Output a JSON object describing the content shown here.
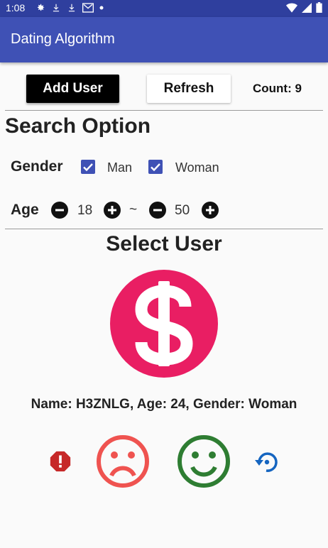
{
  "status_bar": {
    "time": "1:08",
    "icons": [
      "gear-icon",
      "download-icon",
      "download-icon",
      "gmail-icon",
      "dot-icon",
      "wifi-icon",
      "signal-icon",
      "battery-icon"
    ]
  },
  "app_bar": {
    "title": "Dating Algorithm",
    "color": "#3f51b5"
  },
  "toolbar": {
    "add_user_label": "Add User",
    "refresh_label": "Refresh",
    "count_text": "Count: 9"
  },
  "search": {
    "title": "Search Option",
    "gender_label": "Gender",
    "options": [
      {
        "label": "Man",
        "checked": true
      },
      {
        "label": "Woman",
        "checked": true
      }
    ],
    "age_label": "Age",
    "age_min": "18",
    "age_separator": "~",
    "age_max": "50"
  },
  "select": {
    "title": "Select User",
    "avatar_icon": "dollar-icon",
    "avatar_color": "#e91e63",
    "user_info": "Name: H3ZNLG, Age: 24, Gender: Woman"
  },
  "actions": {
    "report_icon": "report-icon",
    "dislike_icon": "sad-face-icon",
    "like_icon": "happy-face-icon",
    "undo_icon": "restore-icon",
    "colors": {
      "report": "#c62828",
      "dislike": "#ef5350",
      "like": "#2e7d32",
      "undo": "#1565c0"
    }
  }
}
